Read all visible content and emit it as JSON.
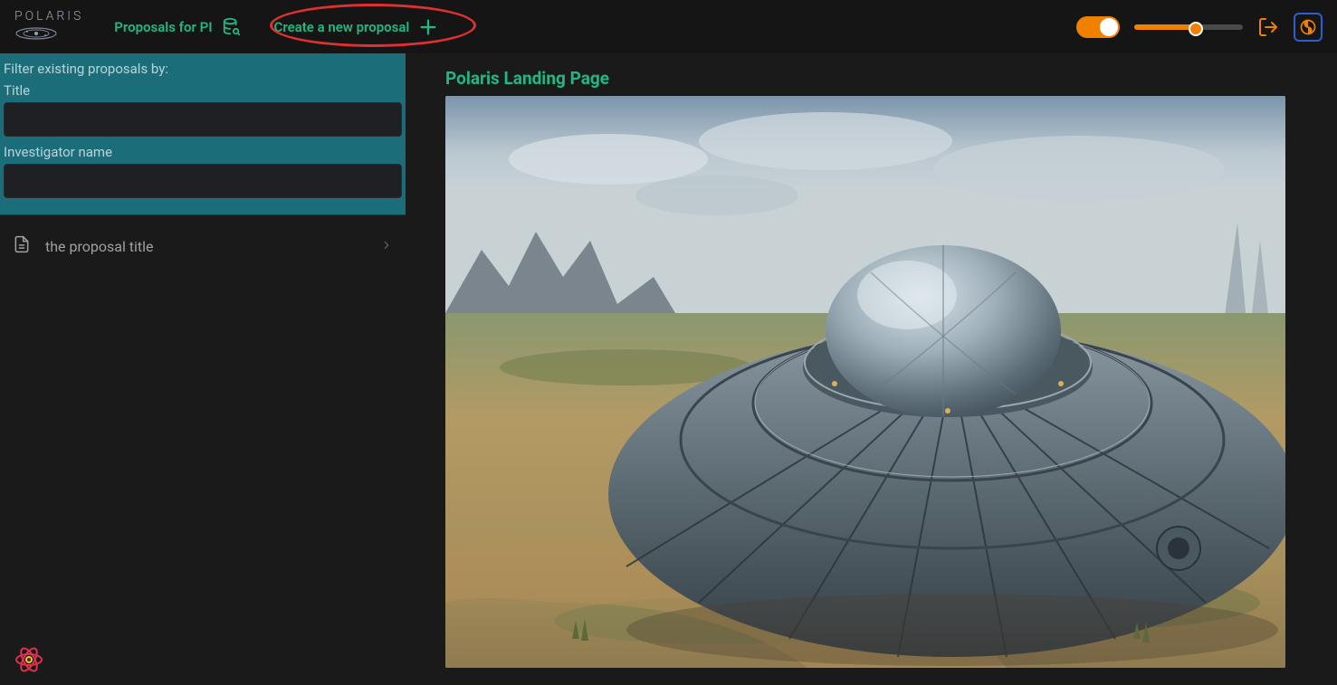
{
  "brand": {
    "name": "POLARIS"
  },
  "nav": {
    "proposals_label": "Proposals for PI",
    "create_label": "Create a new proposal"
  },
  "sidebar": {
    "filter_heading": "Filter existing proposals by:",
    "title_label": "Title",
    "investigator_label": "Investigator name",
    "title_value": "",
    "investigator_value": "",
    "proposals": [
      {
        "title": "the proposal title"
      }
    ]
  },
  "main": {
    "heading": "Polaris Landing Page"
  },
  "colors": {
    "accent": "#1fb884",
    "orange": "#f08000",
    "highlight": "#e03030",
    "teal": "#1c6d7a"
  }
}
